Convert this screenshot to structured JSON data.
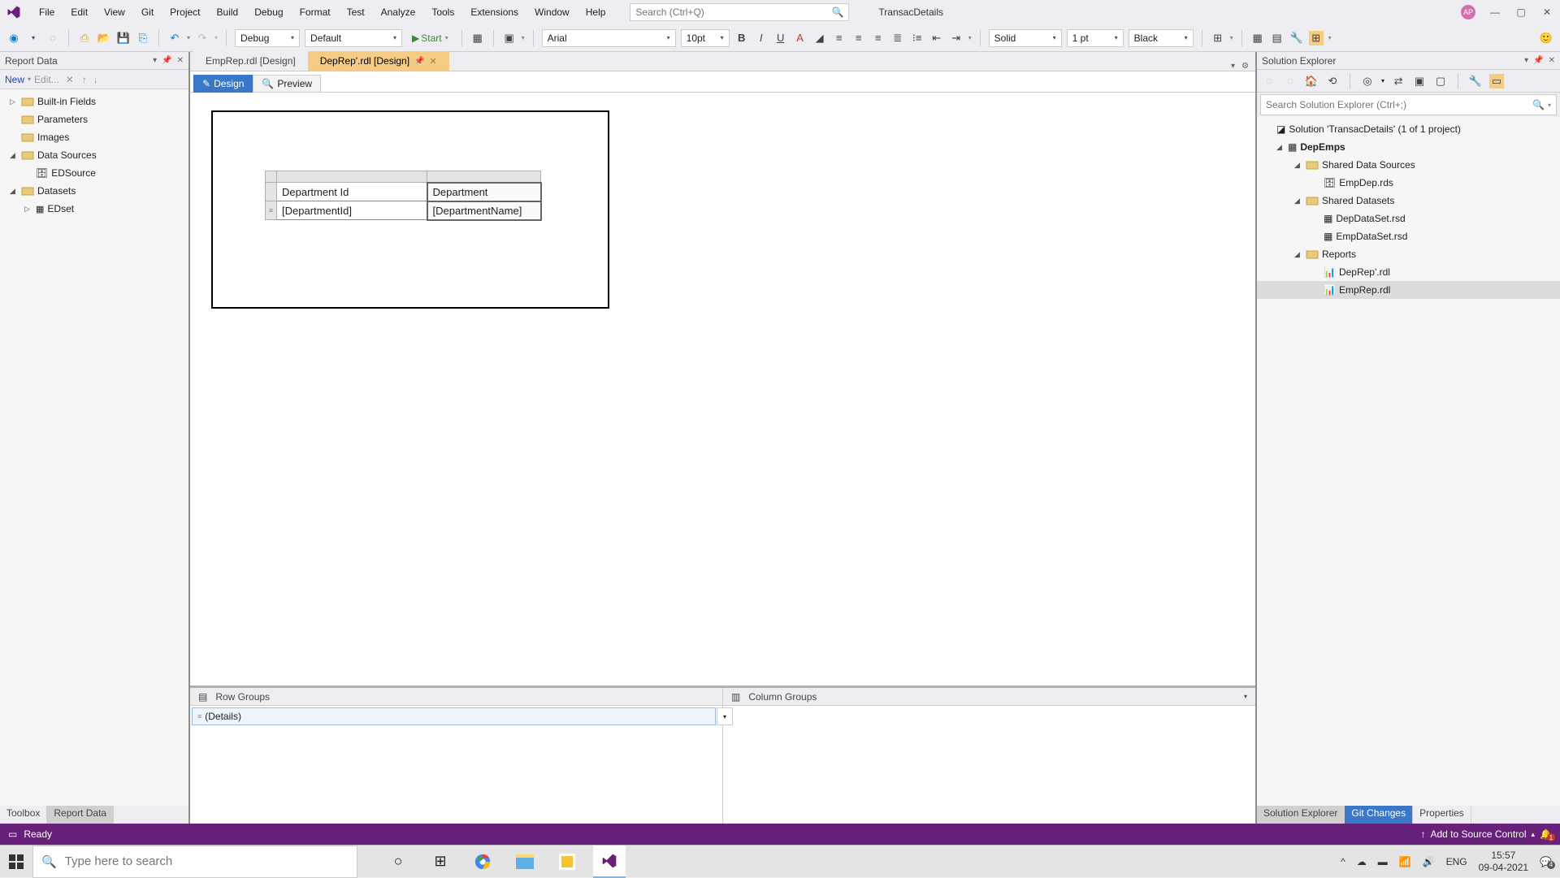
{
  "titlebar": {
    "menus": [
      "File",
      "Edit",
      "View",
      "Git",
      "Project",
      "Build",
      "Debug",
      "Format",
      "Test",
      "Analyze",
      "Tools",
      "Extensions",
      "Window",
      "Help"
    ],
    "search_placeholder": "Search (Ctrl+Q)",
    "project_name": "TransacDetails",
    "avatar_initials": "AP"
  },
  "toolbar": {
    "config": "Debug",
    "platform": "Default",
    "start_label": "Start",
    "font_name": "Arial",
    "font_size": "10pt",
    "border_style": "Solid",
    "border_width": "1 pt",
    "border_color": "Black"
  },
  "report_data": {
    "title": "Report Data",
    "new_label": "New",
    "edit_label": "Edit...",
    "items": [
      {
        "label": "Built-in Fields",
        "caret": "▷",
        "icon": "folder"
      },
      {
        "label": "Parameters",
        "caret": "",
        "icon": "folder"
      },
      {
        "label": "Images",
        "caret": "",
        "icon": "folder"
      },
      {
        "label": "Data Sources",
        "caret": "◢",
        "icon": "folder"
      },
      {
        "label": "EDSource",
        "caret": "",
        "icon": "ds",
        "indent": 1
      },
      {
        "label": "Datasets",
        "caret": "◢",
        "icon": "folder"
      },
      {
        "label": "EDset",
        "caret": "▷",
        "icon": "dset",
        "indent": 1
      }
    ],
    "bottom_tabs": [
      "Toolbox",
      "Report Data"
    ]
  },
  "editor": {
    "tabs": [
      {
        "label": "EmpRep.rdl [Design]",
        "active": false
      },
      {
        "label": "DepRep'.rdl [Design]",
        "active": true
      }
    ],
    "subtabs": {
      "design": "Design",
      "preview": "Preview"
    },
    "tablix": {
      "headers": [
        "Department Id",
        "Department"
      ],
      "data_row": [
        "[DepartmentId]",
        "[DepartmentName]"
      ]
    },
    "row_groups_label": "Row Groups",
    "column_groups_label": "Column Groups",
    "details_label": "(Details)"
  },
  "solution_explorer": {
    "title": "Solution Explorer",
    "search_placeholder": "Search Solution Explorer (Ctrl+;)",
    "solution_line": "Solution 'TransacDetails' (1 of 1 project)",
    "project": "DepEmps",
    "shared_ds": "Shared Data Sources",
    "empdep": "EmpDep.rds",
    "shared_datasets": "Shared Datasets",
    "dep_ds": "DepDataSet.rsd",
    "emp_ds": "EmpDataSet.rsd",
    "reports": "Reports",
    "deprep": "DepRep'.rdl",
    "emprep": "EmpRep.rdl",
    "bottom_tabs": [
      "Solution Explorer",
      "Git Changes",
      "Properties"
    ]
  },
  "statusbar": {
    "ready": "Ready",
    "source_control": "Add to Source Control"
  },
  "taskbar": {
    "search_placeholder": "Type here to search",
    "lang": "ENG",
    "time": "15:57",
    "date": "09-04-2021",
    "notif_count": "1",
    "action_count": "4"
  }
}
